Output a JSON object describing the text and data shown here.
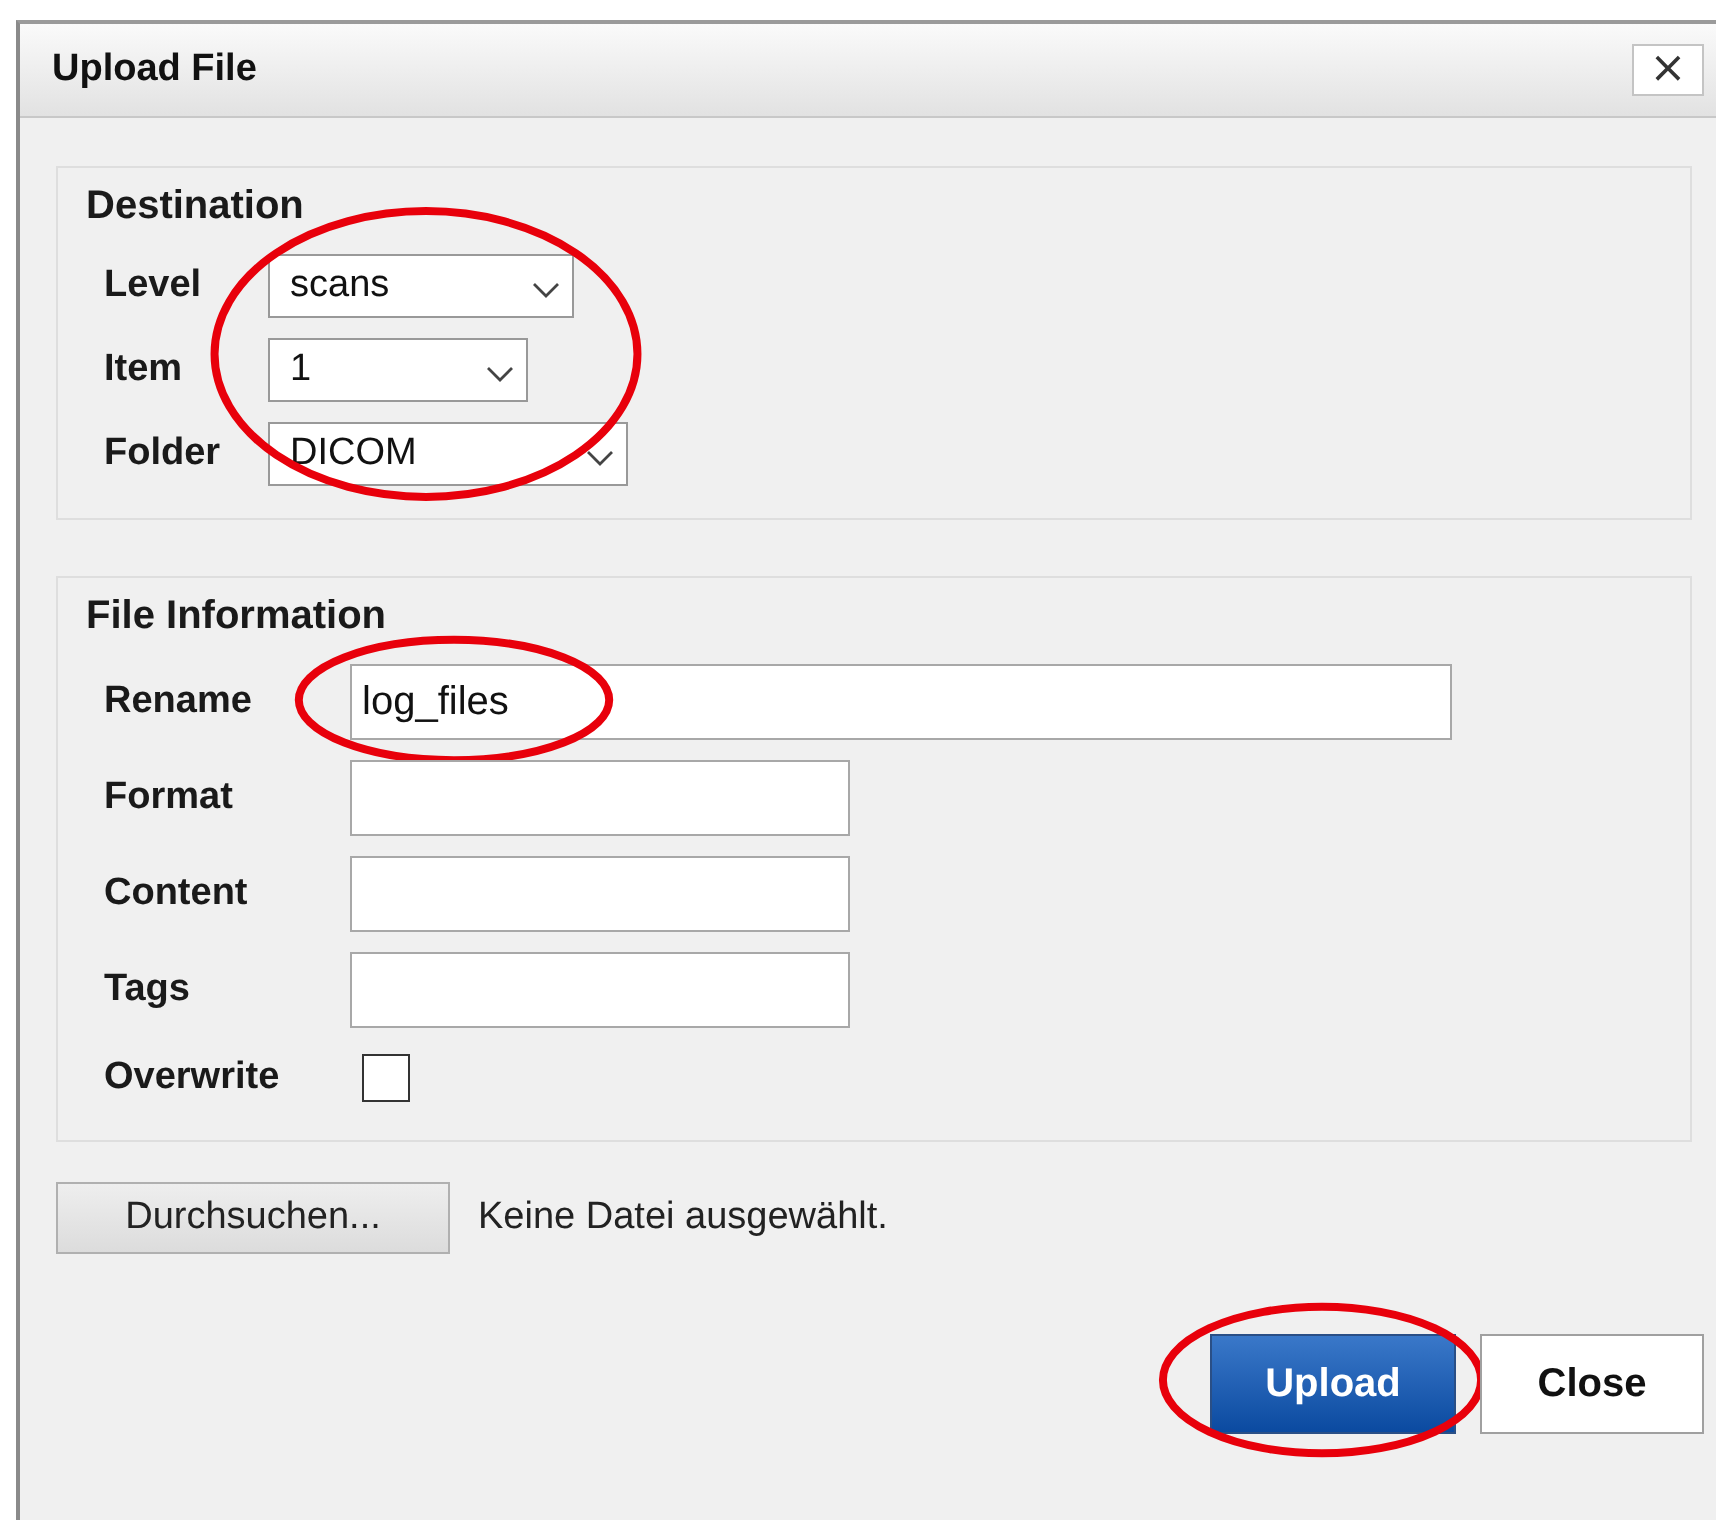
{
  "window": {
    "title": "Upload File",
    "close_label": "×"
  },
  "destination": {
    "heading": "Destination",
    "circled": true,
    "fields": [
      {
        "label": "Level",
        "value": "scans"
      },
      {
        "label": "Item",
        "value": "1"
      },
      {
        "label": "Folder",
        "value": "DICOM"
      }
    ]
  },
  "file_information": {
    "heading": "File Information",
    "fields": [
      {
        "kind": "text",
        "label": "Rename",
        "value": "log_files",
        "circled": true
      },
      {
        "kind": "text",
        "label": "Format",
        "circled": false
      },
      {
        "kind": "text",
        "label": "Content",
        "circled": false
      },
      {
        "kind": "text",
        "label": "Tags",
        "circled": false
      },
      {
        "kind": "checkbox",
        "label": "Overwrite",
        "checked": false,
        "circled": false
      }
    ]
  },
  "file_picker": {
    "button": "Durchsuchen...",
    "status": "Keine Datei ausgewählt."
  },
  "buttons": [
    {
      "label": "Upload",
      "kind": "primary",
      "circled": true
    },
    {
      "label": "Close",
      "kind": "secondary",
      "circled": false
    }
  ]
}
